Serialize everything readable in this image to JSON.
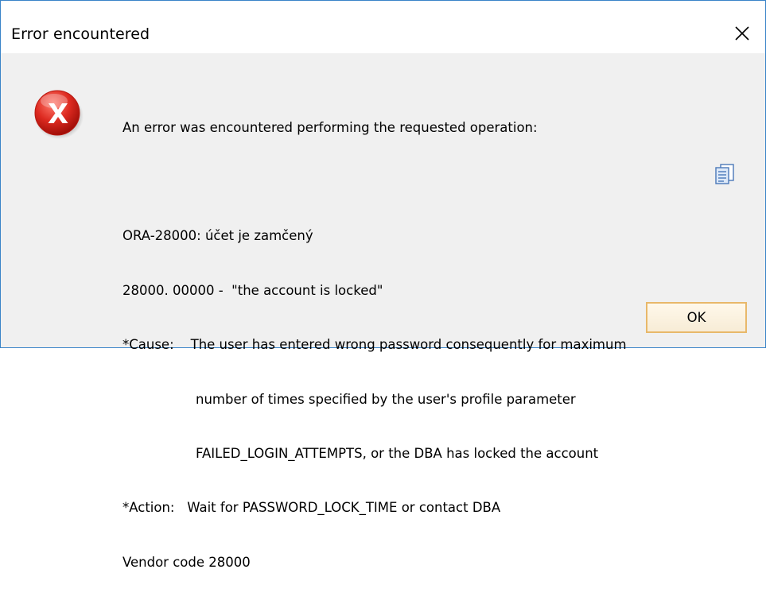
{
  "dialog": {
    "title": "Error encountered",
    "close_symbol": "✕",
    "icon": "error-x-icon",
    "accent_color": "#3a84c8",
    "message_lines": {
      "intro": "An error was encountered performing the requested operation:",
      "ora_code": "ORA-28000: účet je zamčený",
      "state": "28000. 00000 -  \"the account is locked\"",
      "cause_1": "*Cause:    The user has entered wrong password consequently for maximum",
      "cause_2": "number of times specified by the user's profile parameter",
      "cause_3": "FAILED_LOGIN_ATTEMPTS, or the DBA has locked the account",
      "action": "*Action:   Wait for PASSWORD_LOCK_TIME or contact DBA",
      "vendor": "Vendor code 28000"
    },
    "copy_icon": "clipboard-icon",
    "ok_label": "OK"
  }
}
